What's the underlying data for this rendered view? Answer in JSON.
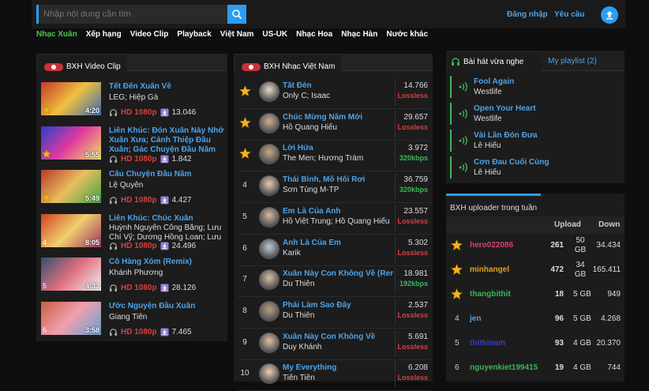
{
  "header": {
    "search_placeholder": "Nhập nội dung cần tìm",
    "login": "Đăng nhập",
    "request": "Yêu cầu"
  },
  "nav": [
    {
      "label": "Nhạc Xuân",
      "active": true
    },
    {
      "label": "Xếp hạng"
    },
    {
      "label": "Video Clip"
    },
    {
      "label": "Playback"
    },
    {
      "label": "Việt Nam"
    },
    {
      "label": "US-UK"
    },
    {
      "label": "Nhạc Hoa"
    },
    {
      "label": "Nhạc Hàn"
    },
    {
      "label": "Nước khác"
    }
  ],
  "video_chart": {
    "title": "BXH Video Clip",
    "items": [
      {
        "title": "Tết Đến Xuân Về",
        "artist": "LEG; Hiệp Gà",
        "quality": "HD 1080p",
        "views": "13.046",
        "duration": "4:20",
        "rank": "1",
        "star": true
      },
      {
        "title": "Liên Khúc: Đón Xuân Này Nhớ Xuân Xưa; Cánh Thiệp Đầu Xuân; Gác Chuyện Đầu Năm",
        "artist": "",
        "quality": "HD 1080p",
        "views": "1.842",
        "duration": "5:55",
        "rank": "2",
        "star": true
      },
      {
        "title": "Câu Chuyện Đầu Năm",
        "artist": "Lệ Quyên",
        "quality": "HD 1080p",
        "views": "4.427",
        "duration": "5:49",
        "rank": "3",
        "star": true
      },
      {
        "title": "Liên Khúc: Chúc Xuân",
        "artist": "Huỳnh Nguyễn Công Bằng; Lưu Chí Vỹ; Dương Hồng Loan; Lưu",
        "quality": "HD 1080p",
        "views": "24.496",
        "duration": "8:05",
        "rank": "4",
        "star": false
      },
      {
        "title": "Cô Hàng Xóm (Remix)",
        "artist": "Khánh Phương",
        "quality": "HD 1080p",
        "views": "28.126",
        "duration": "4:33",
        "rank": "5",
        "star": false
      },
      {
        "title": "Ước Nguyện Đầu Xuân",
        "artist": "Giang Tiên",
        "quality": "HD 1080p",
        "views": "7.465",
        "duration": "3:58",
        "rank": "6",
        "star": false
      }
    ]
  },
  "song_chart": {
    "title": "BXH Nhạc Việt Nam",
    "items": [
      {
        "rank": "1",
        "star": true,
        "title": "Tắt Đèn",
        "artist": "Only C; Isaac",
        "views": "14.766",
        "quality": "Lossless"
      },
      {
        "rank": "2",
        "star": true,
        "title": "Chúc Mừng Năm Mới",
        "artist": "Hồ Quang Hiếu",
        "views": "29.657",
        "quality": "Lossless"
      },
      {
        "rank": "3",
        "star": true,
        "title": "Lời Hứa",
        "artist": "The Men; Hương Tràm",
        "views": "3.972",
        "quality": "320kbps"
      },
      {
        "rank": "4",
        "star": false,
        "title": "Thái Bình, Mồ Hôi Rơi",
        "artist": "Sơn Tùng M-TP",
        "views": "36.759",
        "quality": "320kbps"
      },
      {
        "rank": "5",
        "star": false,
        "title": "Em Là Của Anh",
        "artist": "Hồ Việt Trung; Hồ Quang Hiếu",
        "views": "23.557",
        "quality": "Lossless"
      },
      {
        "rank": "6",
        "star": false,
        "title": "Anh Là Của Em",
        "artist": "Karik",
        "views": "5.302",
        "quality": "Lossless"
      },
      {
        "rank": "7",
        "star": false,
        "title": "Xuân Này Con Không Về (Remix)",
        "artist": "Du Thiên",
        "views": "18.981",
        "quality": "192kbps"
      },
      {
        "rank": "8",
        "star": false,
        "title": "Phải Làm Sao Đây",
        "artist": "Du Thiên",
        "views": "2.537",
        "quality": "Lossless"
      },
      {
        "rank": "9",
        "star": false,
        "title": "Xuân Này Con Không Về",
        "artist": "Duy Khánh",
        "views": "5.691",
        "quality": "Lossless"
      },
      {
        "rank": "10",
        "star": false,
        "title": "My Everything",
        "artist": "Tiên Tiên",
        "views": "6.208",
        "quality": "Lossless"
      }
    ]
  },
  "recent": {
    "tab_recent": "Bài hát vừa nghe",
    "tab_playlist": "My playlist (2)",
    "items": [
      {
        "title": "Fool Again",
        "artist": "Westlife"
      },
      {
        "title": "Open Your Heart",
        "artist": "Westlife"
      },
      {
        "title": "Vài Lần Đón Đưa",
        "artist": "Lê Hiếu"
      },
      {
        "title": "Cơn Đau Cuối Cùng",
        "artist": "Lê Hiếu"
      }
    ]
  },
  "uploaders": {
    "title": "BXH uploader trong tuần",
    "col_upload": "Upload",
    "col_down": "Down",
    "items": [
      {
        "rank": "1",
        "star": true,
        "name": "hero022086",
        "name_color": "#d7406a",
        "count": "261",
        "size": "50\nGB",
        "down": "34.434"
      },
      {
        "rank": "2",
        "star": true,
        "name": "minhangel",
        "name_color": "#e0a020",
        "count": "472",
        "size": "34\nGB",
        "down": "165.411"
      },
      {
        "rank": "3",
        "star": true,
        "name": "thangbithit",
        "name_color": "#3fb55a",
        "count": "18",
        "size": "5 GB",
        "down": "949"
      },
      {
        "rank": "4",
        "star": false,
        "name": "jen",
        "name_color": "#4da3e8",
        "count": "96",
        "size": "5 GB",
        "down": "4.268"
      },
      {
        "rank": "5",
        "star": false,
        "name": "thithinam",
        "name_color": "#3a3acc",
        "count": "93",
        "size": "4 GB",
        "down": "20.370"
      },
      {
        "rank": "6",
        "star": false,
        "name": "nguyenkiet199415",
        "name_color": "#3fb55a",
        "count": "19",
        "size": "4 GB",
        "down": "744"
      }
    ]
  },
  "colors": {
    "accent": "#2a9df4",
    "link": "#4da3e8",
    "hd": "#e23b3b",
    "lossless": "#e23b3b",
    "kbps": "#3fb55a",
    "active_nav": "#46c94a"
  }
}
